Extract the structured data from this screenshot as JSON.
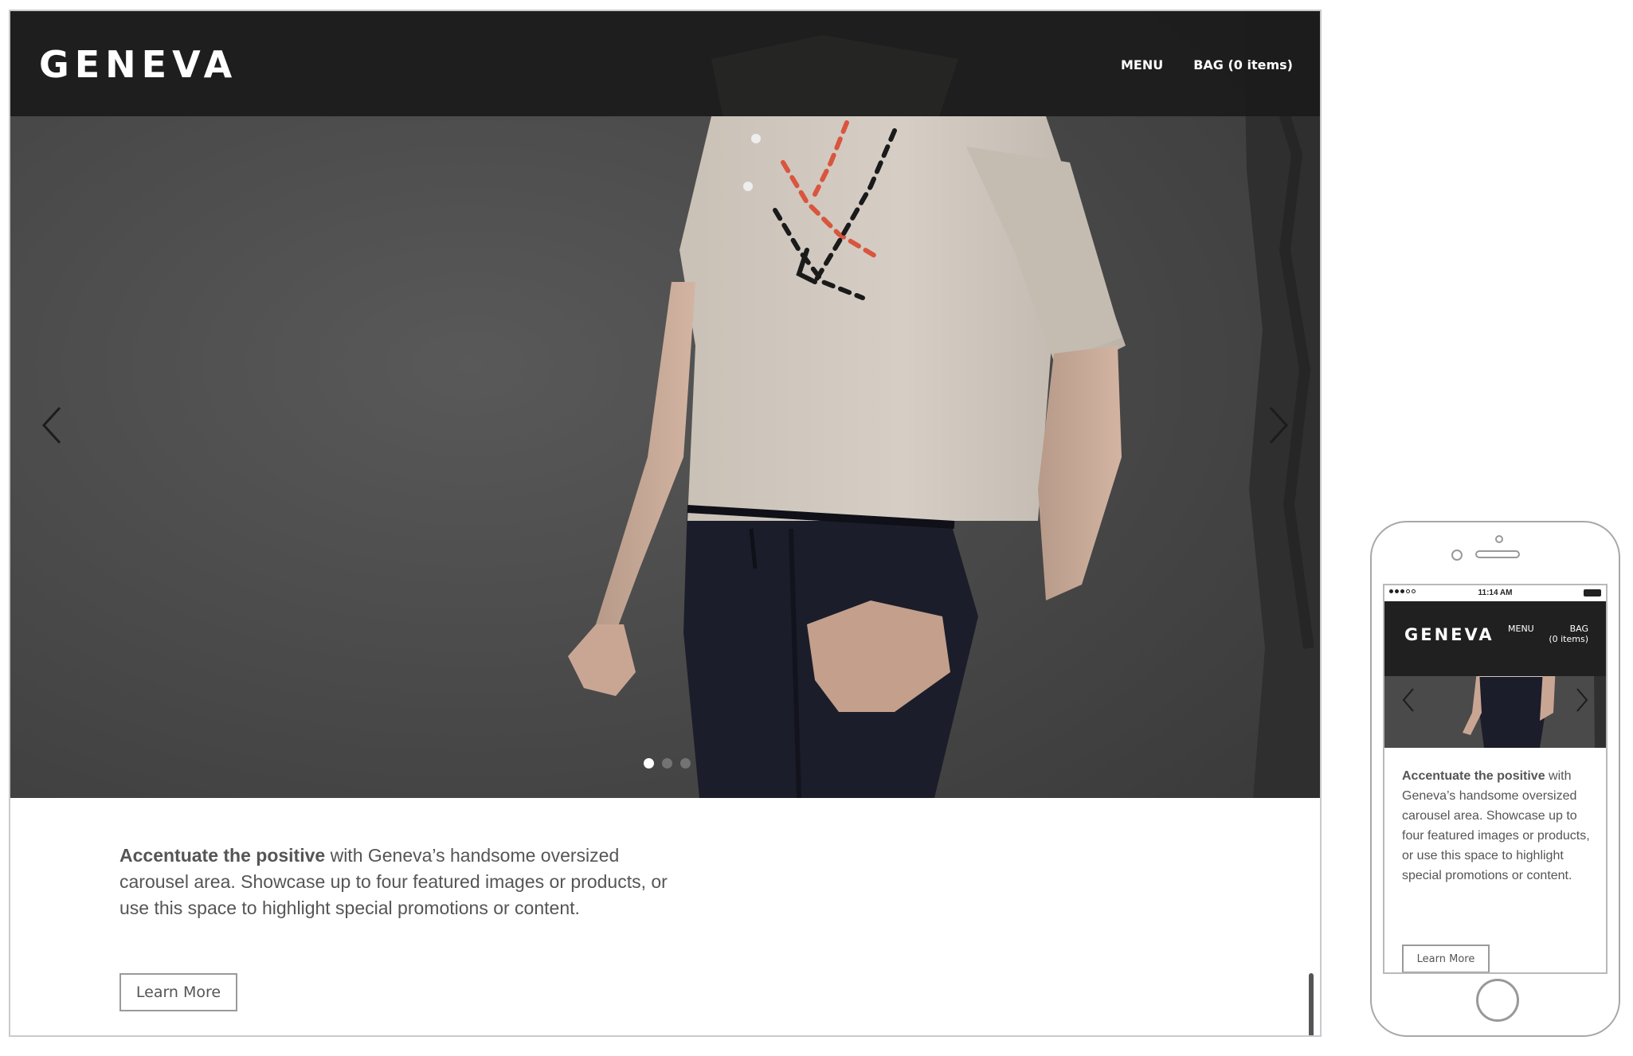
{
  "desktop": {
    "logo": "GENEVA",
    "nav": {
      "menu": "MENU",
      "bag": "BAG (0 items)"
    },
    "carousel": {
      "slide_count": 3,
      "active_slide": 1
    },
    "description": {
      "bold": "Accentuate the positive",
      "rest": " with Geneva’s handsome oversized carousel area. Showcase up to four featured images or products, or use this space to highlight special promotions or content."
    },
    "cta": "Learn More"
  },
  "phone": {
    "status_time": "11:14 AM",
    "logo": "GENEVA",
    "nav": {
      "menu": "MENU",
      "bag_line1": "BAG",
      "bag_line2": "(0 items)"
    },
    "description": {
      "bold": "Accentuate the positive",
      "rest": " with Geneva’s handsome oversized carousel area. Showcase up to four featured images or products, or use this space to highlight special promotions or content."
    },
    "cta": "Learn More"
  },
  "colors": {
    "header_bg": "#1c1c1c",
    "hero_wall": "#484848",
    "shirt": "#cfc6bd",
    "trousers": "#1b1d2a",
    "accent_red": "#d9553e",
    "text": "#555555"
  }
}
